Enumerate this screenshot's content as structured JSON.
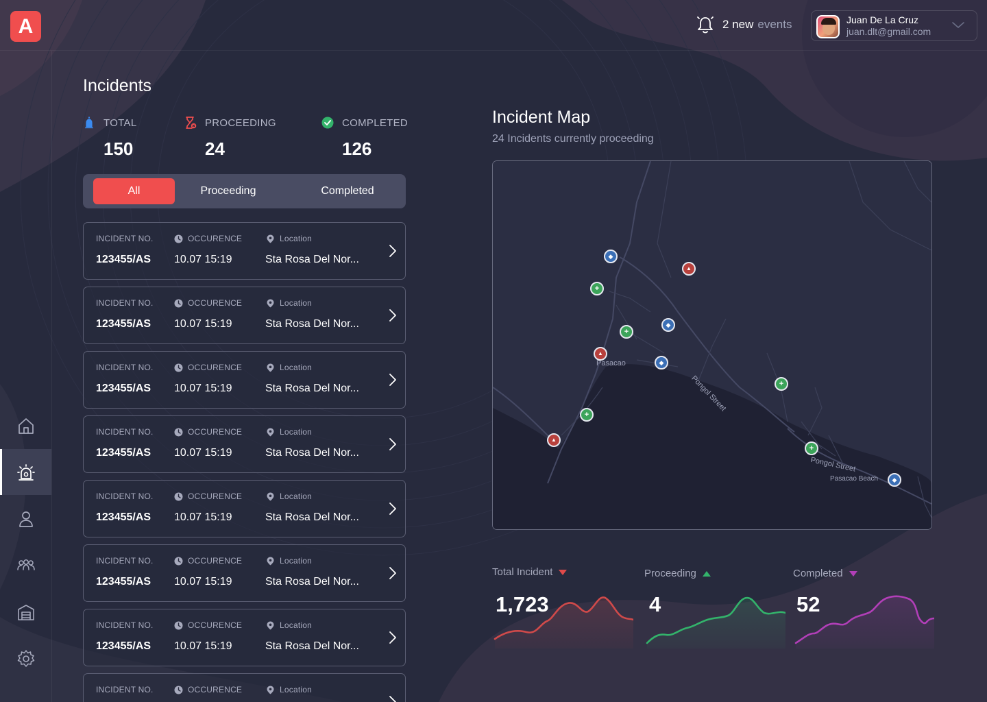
{
  "app": {
    "logo_letter": "A",
    "brand_color": "#f04e4e"
  },
  "header": {
    "notifications_count": "2 new",
    "notifications_label": "events",
    "user_name": "Juan De La Cruz",
    "user_email": "juan.dlt@gmail.com"
  },
  "sidebar": {
    "items": [
      {
        "icon": "home-icon",
        "active": false
      },
      {
        "icon": "siren-icon",
        "active": true
      },
      {
        "icon": "user-icon",
        "active": false
      },
      {
        "icon": "team-icon",
        "active": false
      },
      {
        "icon": "building-icon",
        "active": false
      },
      {
        "icon": "gear-icon",
        "active": false
      }
    ]
  },
  "incidents": {
    "title": "Incidents",
    "stats": [
      {
        "label": "TOTAL",
        "value": "150",
        "icon": "siren-icon",
        "color": "#3b8bf0"
      },
      {
        "label": "PROCEEDING",
        "value": "24",
        "icon": "hourglass-icon",
        "color": "#f04e4e"
      },
      {
        "label": "COMPLETED",
        "value": "126",
        "icon": "check-circle-icon",
        "color": "#33b36b"
      }
    ],
    "tabs": [
      {
        "label": "All",
        "active": true
      },
      {
        "label": "Proceeding",
        "active": false
      },
      {
        "label": "Completed",
        "active": false
      }
    ],
    "columns": {
      "number": "INCIDENT NO.",
      "occurrence": "OCCURENCE",
      "location": "Location"
    },
    "rows": [
      {
        "number": "123455/AS",
        "occurrence": "10.07 15:19",
        "location": "Sta Rosa Del Nor..."
      },
      {
        "number": "123455/AS",
        "occurrence": "10.07 15:19",
        "location": "Sta Rosa Del Nor..."
      },
      {
        "number": "123455/AS",
        "occurrence": "10.07 15:19",
        "location": "Sta Rosa Del Nor..."
      },
      {
        "number": "123455/AS",
        "occurrence": "10.07 15:19",
        "location": "Sta Rosa Del Nor..."
      },
      {
        "number": "123455/AS",
        "occurrence": "10.07 15:19",
        "location": "Sta Rosa Del Nor..."
      },
      {
        "number": "123455/AS",
        "occurrence": "10.07 15:19",
        "location": "Sta Rosa Del Nor..."
      },
      {
        "number": "123455/AS",
        "occurrence": "10.07 15:19",
        "location": "Sta Rosa Del Nor..."
      },
      {
        "number": "",
        "occurrence": "",
        "location": ""
      }
    ]
  },
  "map": {
    "title": "Incident Map",
    "subtitle": "24 Incidents currently proceeding",
    "labels": {
      "town": "Pasacao",
      "street1": "Pongol Street",
      "street2": "Pongol Street",
      "beach": "Pasacao Beach"
    },
    "pins": [
      {
        "type": "police"
      },
      {
        "type": "fire"
      },
      {
        "type": "medic"
      },
      {
        "type": "police"
      },
      {
        "type": "medic"
      },
      {
        "type": "fire"
      },
      {
        "type": "police"
      },
      {
        "type": "medic"
      },
      {
        "type": "medic"
      },
      {
        "type": "fire"
      },
      {
        "type": "medic"
      },
      {
        "type": "police"
      }
    ]
  },
  "summary": [
    {
      "label": "Total Incident",
      "value": "1,723",
      "trend": "down",
      "color": "#d04a4a",
      "trend_color": "#e04a4a"
    },
    {
      "label": "Proceeding",
      "value": "4",
      "trend": "up",
      "color": "#33b36b",
      "trend_color": "#33b36b"
    },
    {
      "label": "Completed",
      "value": "52",
      "trend": "down",
      "color": "#b23fb8",
      "trend_color": "#b23fb8"
    }
  ]
}
